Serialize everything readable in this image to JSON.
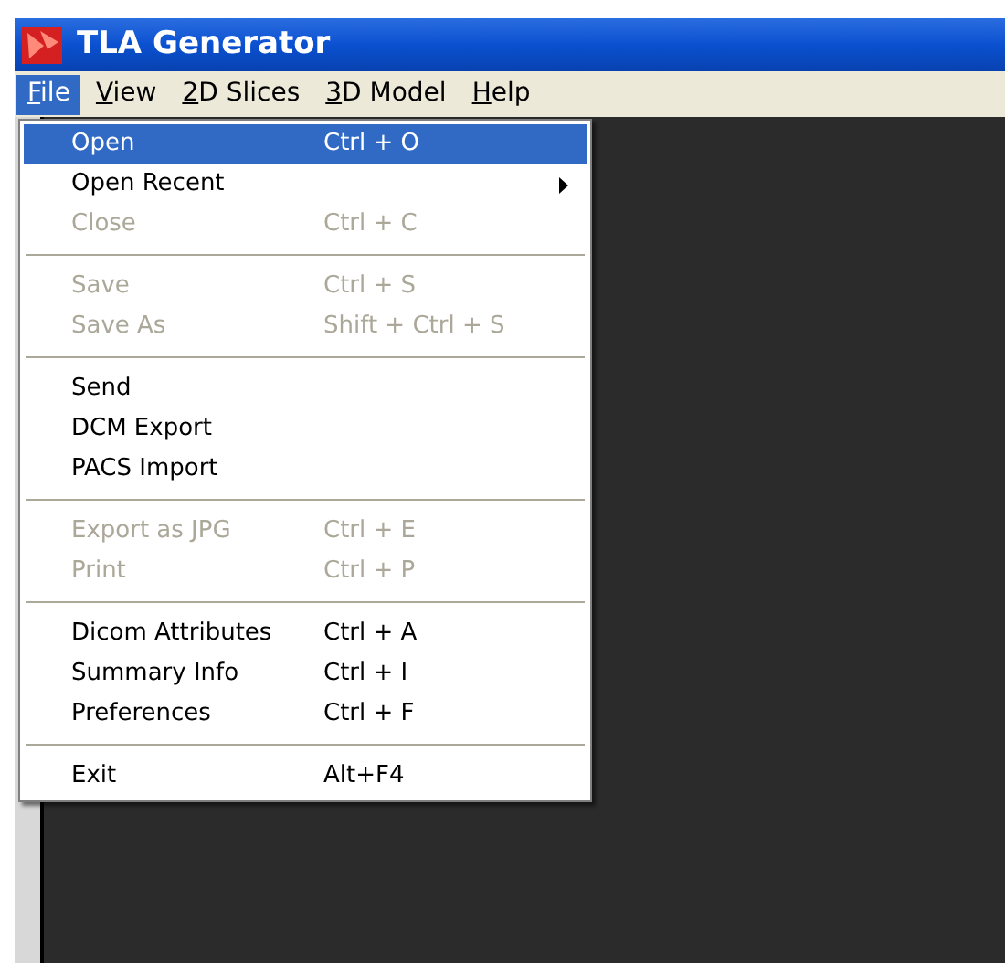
{
  "window": {
    "title": "TLA Generator"
  },
  "menubar": [
    {
      "label": "File",
      "selected": true
    },
    {
      "label": "View",
      "selected": false
    },
    {
      "label": "2D Slices",
      "selected": false
    },
    {
      "label": "3D Model",
      "selected": false
    },
    {
      "label": "Help",
      "selected": false
    }
  ],
  "file_menu": {
    "groups": [
      {
        "items": [
          {
            "label": "Open",
            "shortcut": "Ctrl + O",
            "disabled": false,
            "selected": true,
            "submenu": false
          },
          {
            "label": "Open Recent",
            "disabled": false,
            "selected": false,
            "submenu": true
          },
          {
            "label": "Close",
            "shortcut": "Ctrl + C",
            "disabled": true,
            "selected": false,
            "submenu": false
          }
        ]
      },
      {
        "items": [
          {
            "label": "Save",
            "shortcut": "Ctrl + S",
            "disabled": true,
            "selected": false,
            "submenu": false
          },
          {
            "label": "Save As",
            "shortcut": "Shift + Ctrl + S",
            "disabled": true,
            "selected": false,
            "submenu": false
          }
        ]
      },
      {
        "items": [
          {
            "label": "Send",
            "disabled": false,
            "selected": false,
            "submenu": false
          },
          {
            "label": "DCM Export",
            "disabled": false,
            "selected": false,
            "submenu": false
          },
          {
            "label": "PACS Import",
            "disabled": false,
            "selected": false,
            "submenu": false
          }
        ]
      },
      {
        "items": [
          {
            "label": "Export as JPG",
            "shortcut": "Ctrl + E",
            "disabled": true,
            "selected": false,
            "submenu": false
          },
          {
            "label": "Print",
            "shortcut": "Ctrl + P",
            "disabled": true,
            "selected": false,
            "submenu": false
          }
        ]
      },
      {
        "items": [
          {
            "label": "Dicom Attributes",
            "shortcut": "Ctrl + A",
            "disabled": false,
            "selected": false,
            "submenu": false
          },
          {
            "label": "Summary Info",
            "shortcut": "Ctrl + I",
            "disabled": false,
            "selected": false,
            "submenu": false
          },
          {
            "label": "Preferences",
            "shortcut": "Ctrl + F",
            "disabled": false,
            "selected": false,
            "submenu": false
          }
        ]
      },
      {
        "items": [
          {
            "label": "Exit",
            "shortcut": "Alt+F4",
            "disabled": false,
            "selected": false,
            "submenu": false
          }
        ]
      }
    ]
  }
}
